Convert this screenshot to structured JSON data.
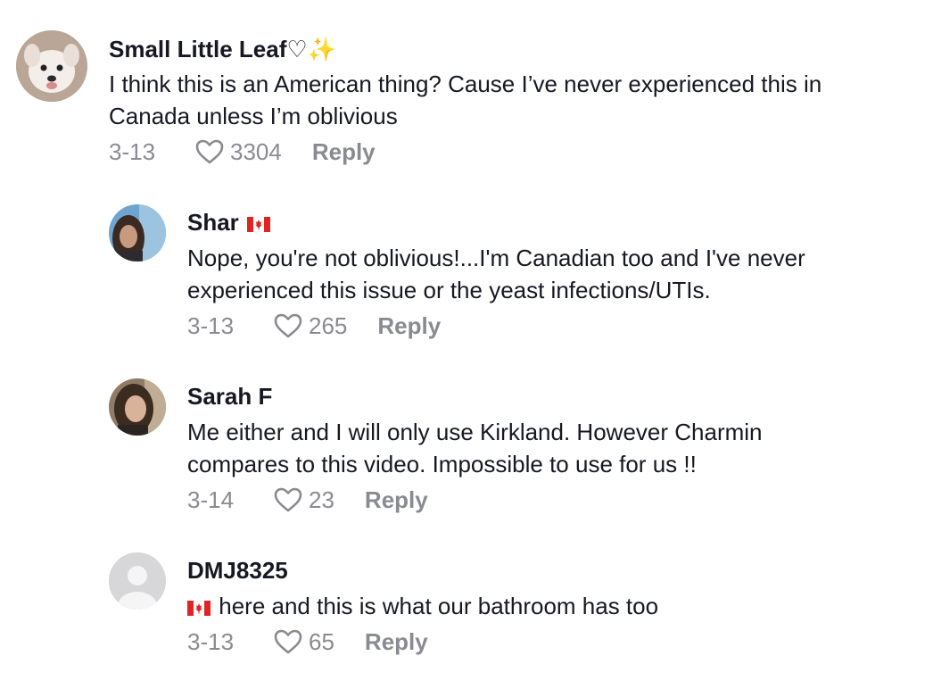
{
  "comments": [
    {
      "username": "Small Little Leaf",
      "username_suffix": "♡✨",
      "text_line1": "I think this is an American thing? Cause I’ve never experienced this in",
      "text_line2": "Canada unless I’m oblivious",
      "date": "3-13",
      "likes": "3304",
      "reply": "Reply",
      "avatar": "white-puppy"
    },
    {
      "username": "Shar",
      "flag": "canada-flag",
      "text_line1": "Nope, you're not oblivious!...I'm Canadian too and I've never",
      "text_line2": "experienced this issue or the yeast infections/UTIs.",
      "date": "3-13",
      "likes": "265",
      "reply": "Reply",
      "avatar": "woman-portrait"
    },
    {
      "username": "Sarah F",
      "text_line1": "Me either and I will only use Kirkland. However Charmin",
      "text_line2": "compares to this video. Impossible to use for us !!",
      "date": "3-14",
      "likes": "23",
      "reply": "Reply",
      "avatar": "woman-portrait"
    },
    {
      "username": "DMJ8325",
      "text_line1": "here and this is what our bathroom has too",
      "date": "3-13",
      "likes": "65",
      "reply": "Reply",
      "avatar": "default-user"
    }
  ],
  "colors": {
    "text": "#161823",
    "muted": "#8a8b91",
    "flag_red": "#e02424"
  }
}
